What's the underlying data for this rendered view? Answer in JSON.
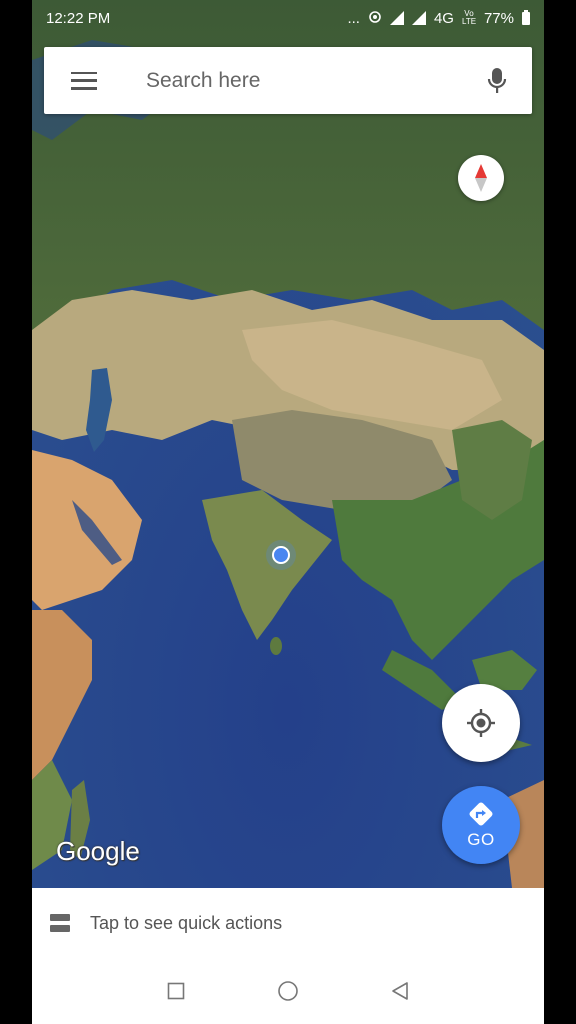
{
  "status_bar": {
    "time": "12:22 PM",
    "dots": "...",
    "network": "4G",
    "volte": "Vo LTE",
    "battery": "77%"
  },
  "search": {
    "placeholder": "Search here"
  },
  "map": {
    "attribution": "Google"
  },
  "fab": {
    "go_label": "GO"
  },
  "quick_actions": {
    "label": "Tap to see quick actions"
  },
  "colors": {
    "accent": "#4285f4",
    "ocean": "#2a4b8e",
    "location_dot": "#4a86f0"
  },
  "icons": {
    "menu": "menu-icon",
    "mic": "mic-icon",
    "compass": "compass-icon",
    "locate": "my-location-icon",
    "directions": "directions-icon",
    "quick_actions": "quick-actions-icon",
    "nav_recent": "recent-apps-icon",
    "nav_home": "home-icon",
    "nav_back": "back-icon"
  }
}
